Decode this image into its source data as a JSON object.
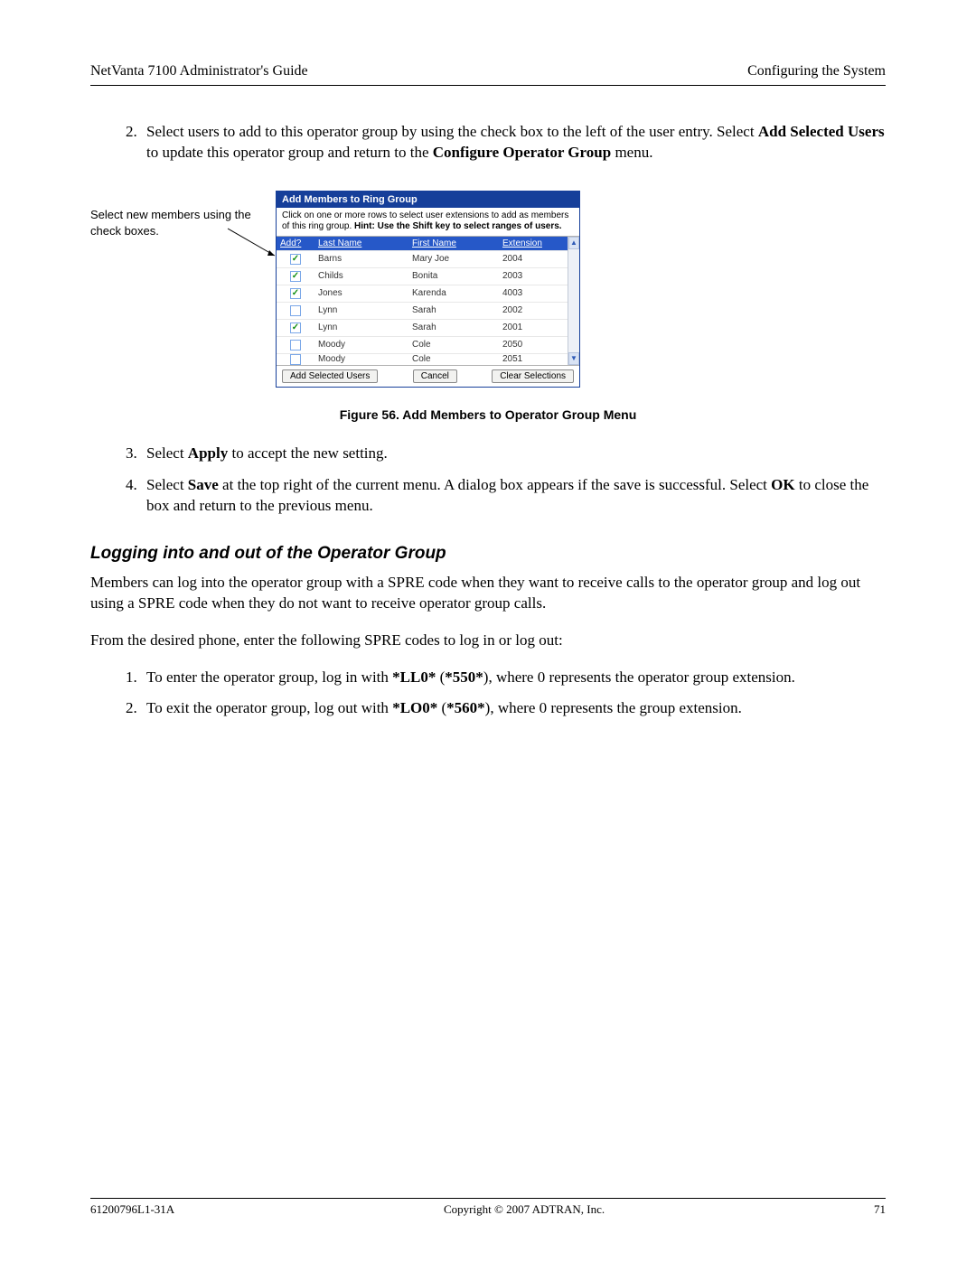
{
  "header": {
    "left": "NetVanta 7100 Administrator's Guide",
    "right": "Configuring the System"
  },
  "steps_a": {
    "item2": {
      "pre": "Select users to add to this operator group by using the check box to the left of the user entry. Select ",
      "b1": "Add Selected Users",
      "mid": " to update this operator group and return to the ",
      "b2": "Configure Operator Group",
      "post": " menu."
    }
  },
  "annotation": "Select new members using the check boxes.",
  "dialog": {
    "title": "Add Members to Ring Group",
    "hint_pre": "Click on one or more rows to select user extensions to add as members of this ring group. ",
    "hint_bold": "Hint: Use the Shift key to select ranges of users.",
    "cols": {
      "add": "Add?",
      "last": "Last Name",
      "first": "First Name",
      "ext": "Extension"
    },
    "rows": [
      {
        "checked": true,
        "last": "Barns",
        "first": "Mary Joe",
        "ext": "2004"
      },
      {
        "checked": true,
        "last": "Childs",
        "first": "Bonita",
        "ext": "2003"
      },
      {
        "checked": true,
        "last": "Jones",
        "first": "Karenda",
        "ext": "4003"
      },
      {
        "checked": false,
        "last": "Lynn",
        "first": "Sarah",
        "ext": "2002"
      },
      {
        "checked": true,
        "last": "Lynn",
        "first": "Sarah",
        "ext": "2001"
      },
      {
        "checked": false,
        "last": "Moody",
        "first": "Cole",
        "ext": "2050"
      },
      {
        "checked": false,
        "last": "Moody",
        "first": "Cole",
        "ext": "2051"
      }
    ],
    "buttons": {
      "add": "Add Selected Users",
      "cancel": "Cancel",
      "clear": "Clear Selections"
    }
  },
  "figure_caption": "Figure 56.  Add Members to Operator Group Menu",
  "steps_b": {
    "item3": {
      "pre": "Select ",
      "b1": "Apply",
      "post": " to accept the new setting."
    },
    "item4": {
      "pre": "Select ",
      "b1": "Save",
      "mid": " at the top right of the current menu. A dialog box appears if the save is successful. Select ",
      "b2": "OK",
      "post": " to close the box and return to the previous menu."
    }
  },
  "section_title": "Logging into and out of the Operator Group",
  "para1": "Members can log into the operator group with a SPRE code when they want to receive calls to the operator group and log out using a SPRE code when they do not want to receive operator group calls.",
  "para2": "From the desired phone, enter the following SPRE codes to log in or log out:",
  "steps_c": {
    "item1": {
      "pre": "To enter the operator group, log in with ",
      "b1": "*LL0*",
      "mid": " (",
      "b2": "*550*",
      "post": "), where 0 represents the operator group extension."
    },
    "item2": {
      "pre": "To exit the operator group, log out with ",
      "b1": "*LO0*",
      "mid": " (",
      "b2": "*560*",
      "post": "), where 0 represents the group extension."
    }
  },
  "footer": {
    "left": "61200796L1-31A",
    "center": "Copyright © 2007 ADTRAN, Inc.",
    "right": "71"
  }
}
